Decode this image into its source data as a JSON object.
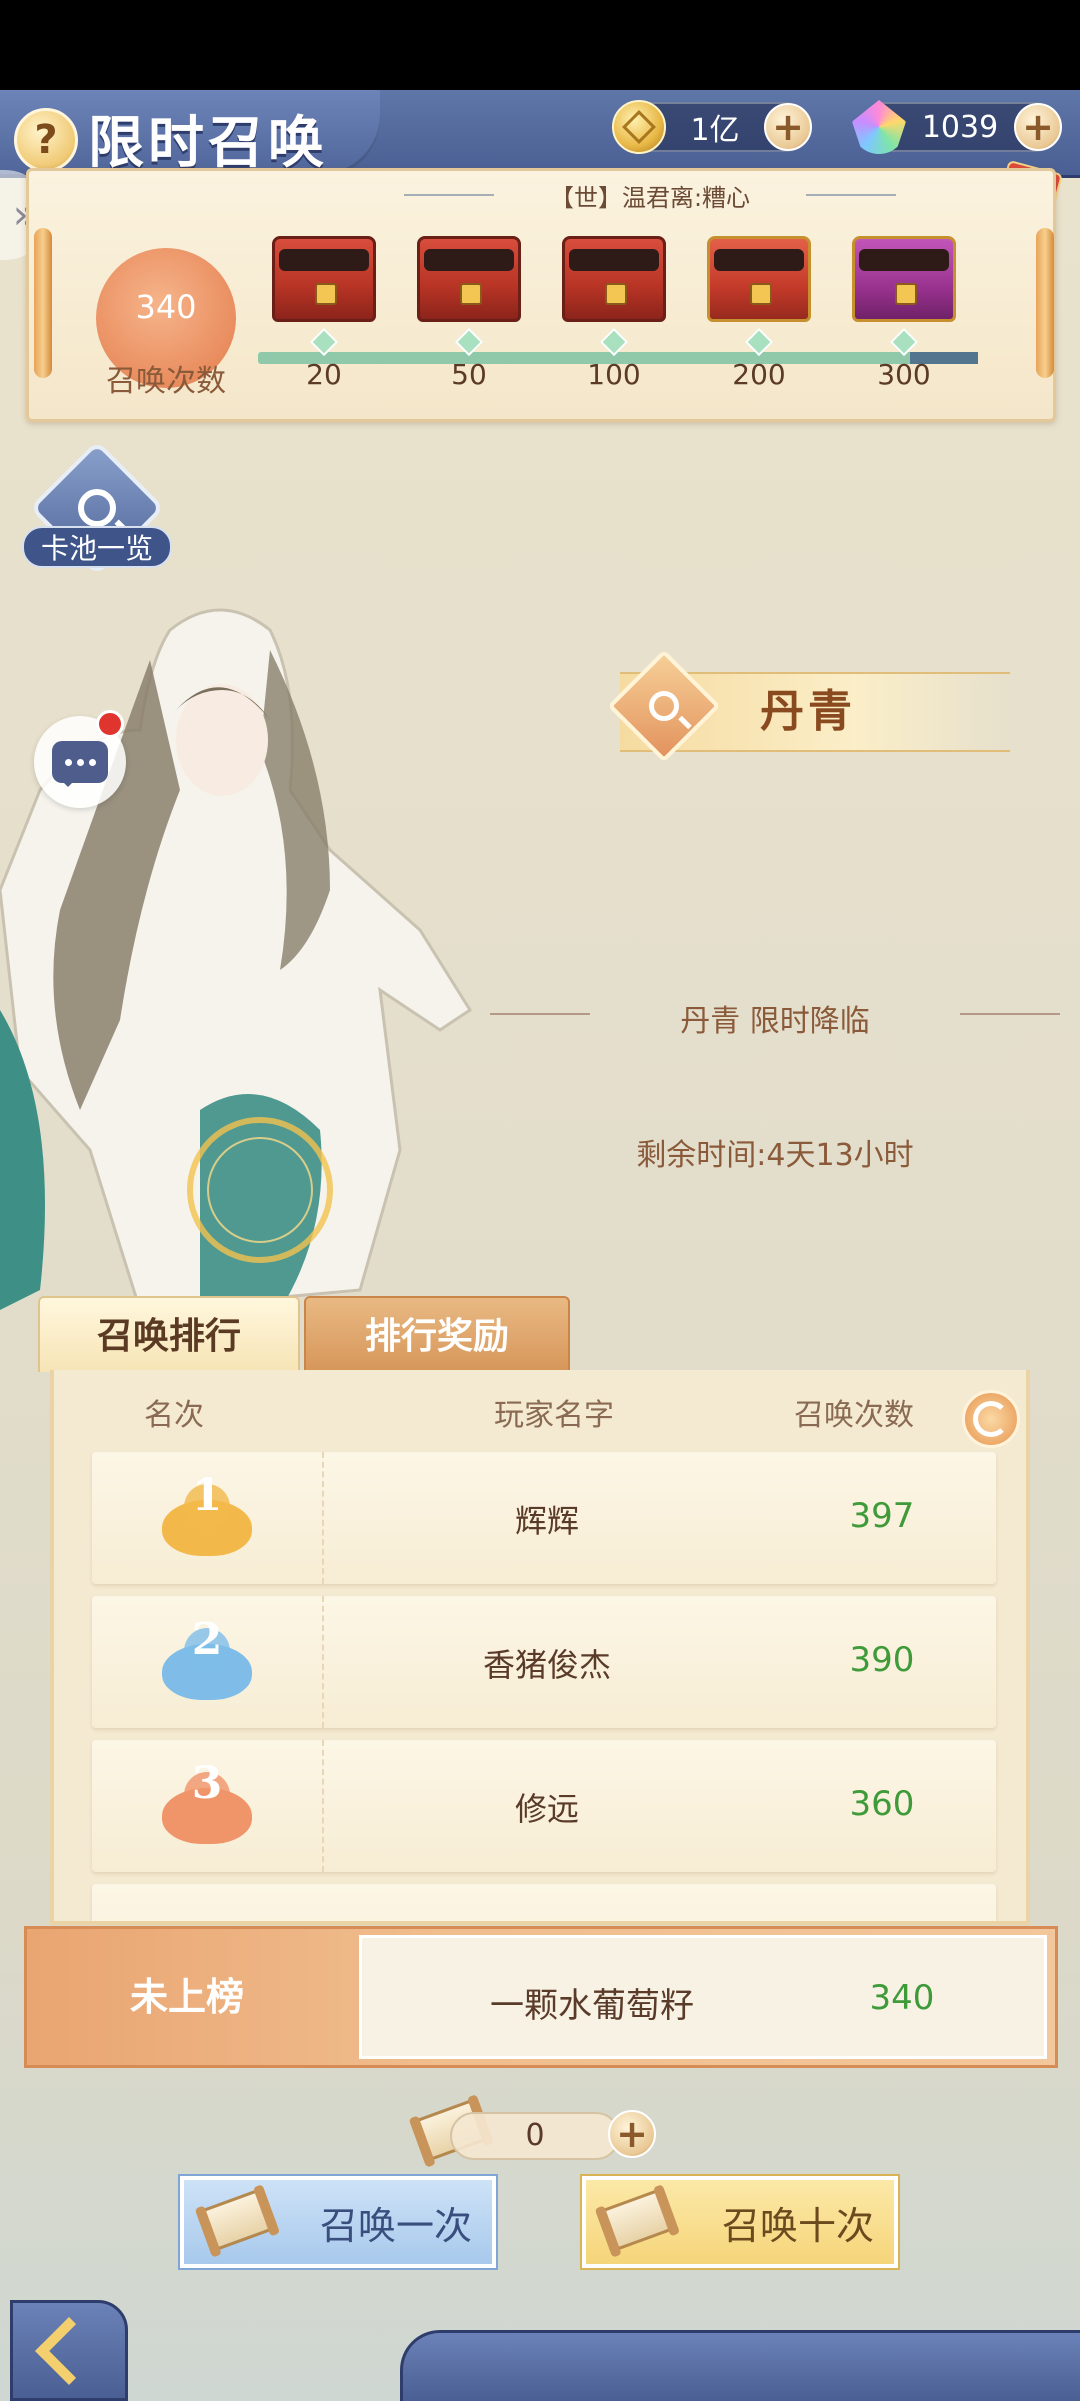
{
  "header": {
    "title": "限时召唤",
    "help_icon": "question-icon",
    "coins": "1亿",
    "gems": "1039"
  },
  "progress": {
    "title": "【世】温君离:糟心",
    "count": "340",
    "count_label": "召唤次数",
    "milestones": [
      {
        "value": "20",
        "chest": "chest-red"
      },
      {
        "value": "50",
        "chest": "chest-red"
      },
      {
        "value": "100",
        "chest": "chest-red"
      },
      {
        "value": "200",
        "chest": "chest-gold"
      },
      {
        "value": "300",
        "chest": "chest-purple"
      }
    ]
  },
  "side": {
    "pool_label": "卡池一览"
  },
  "feature": {
    "name": "丹青",
    "announce": "丹青 限时降临",
    "remaining": "剩余时间:4天13小时"
  },
  "tabs": {
    "ranking": "召唤排行",
    "rewards": "排行奖励"
  },
  "ranking": {
    "headers": [
      "名次",
      "玩家名字",
      "召唤次数"
    ],
    "rows": [
      {
        "rank": "1",
        "name": "辉辉",
        "count": "397",
        "color": "#f2b94a"
      },
      {
        "rank": "2",
        "name": "香猪俊杰",
        "count": "390",
        "color": "#7fbde8"
      },
      {
        "rank": "3",
        "name": "修远",
        "count": "360",
        "color": "#f0946a"
      }
    ],
    "me": {
      "label": "未上榜",
      "name": "一颗水葡萄籽",
      "count": "340"
    }
  },
  "actions": {
    "tickets": "0",
    "summon_one": "召唤一次",
    "summon_ten": "召唤十次"
  }
}
